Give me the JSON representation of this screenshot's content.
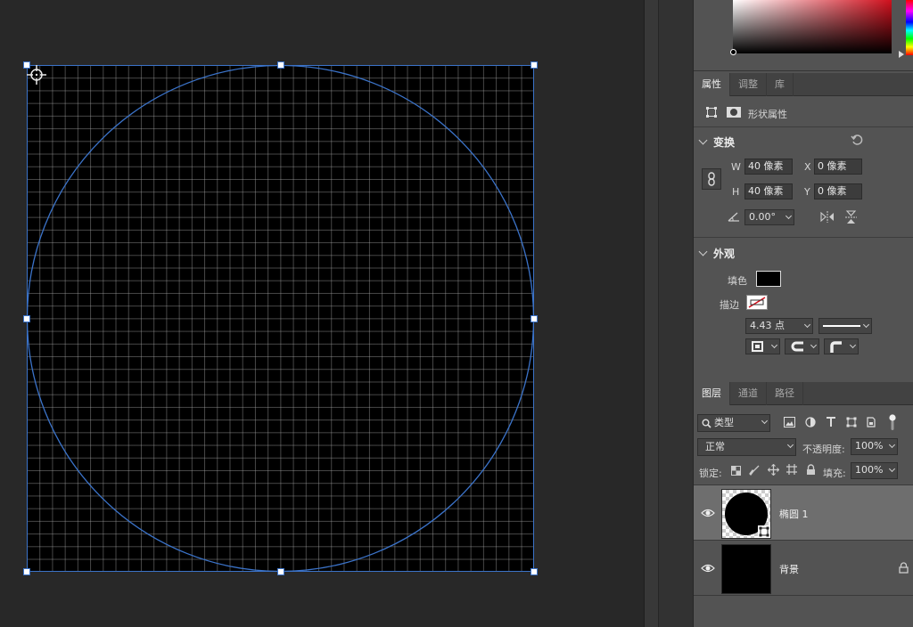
{
  "app": {
    "accent_color": "#3b73c9",
    "panel_bg": "#535353",
    "canvas_bg": "#282828"
  },
  "canvas": {
    "shape": "ellipse",
    "shape_stroke_color": "#3b73c9",
    "grid": true,
    "icons": {
      "center": "crosshair-icon",
      "handles": "transform-handle-icon"
    }
  },
  "color_panel": {
    "hue_color": "#d0101d"
  },
  "properties": {
    "tabs": [
      {
        "label": "属性",
        "active": true
      },
      {
        "label": "调整",
        "active": false
      },
      {
        "label": "库",
        "active": false
      }
    ],
    "shape_properties_label": "形状属性",
    "transform": {
      "title": "变换",
      "w_label": "W",
      "w_value": "40 像素",
      "h_label": "H",
      "h_value": "40 像素",
      "x_label": "X",
      "x_value": "0 像素",
      "y_label": "Y",
      "y_value": "0 像素",
      "angle_value": "0.00°"
    },
    "appearance": {
      "title": "外观",
      "fill_label": "填色",
      "fill_color": "#000000",
      "stroke_label": "描边",
      "stroke_width": "4.43 点"
    }
  },
  "layers_panel": {
    "tabs": [
      {
        "label": "图层",
        "active": true
      },
      {
        "label": "通道",
        "active": false
      },
      {
        "label": "路径",
        "active": false
      }
    ],
    "filter_kind": "类型",
    "blend_mode": "正常",
    "opacity_label": "不透明度:",
    "opacity_value": "100%",
    "lock_label": "锁定:",
    "fill_label": "填充:",
    "fill_value": "100%",
    "layers": [
      {
        "name": "椭圆 1",
        "visible": true,
        "selected": true
      },
      {
        "name": "背景",
        "visible": true,
        "selected": false,
        "locked": true
      }
    ]
  }
}
